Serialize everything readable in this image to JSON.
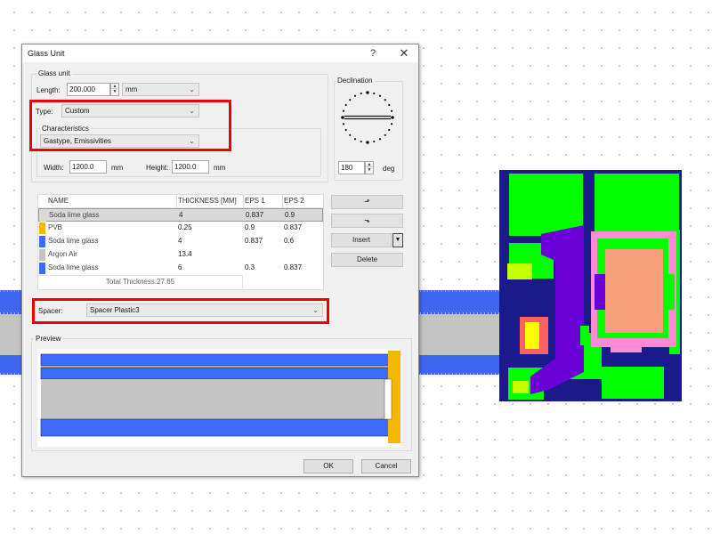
{
  "window": {
    "title": "Glass Unit",
    "help": "?",
    "close": "✕"
  },
  "glass_unit": {
    "group_label": "Glass unit",
    "length_label": "Length:",
    "length_value": "200.000",
    "length_unit": "mm",
    "type_label": "Type:",
    "type_value": "Custom",
    "characteristics_label": "Characteristics",
    "characteristics_value": "Gastype, Emissivities",
    "width_label": "Width:",
    "width_value": "1200.0",
    "width_unit": "mm",
    "height_label": "Height:",
    "height_value": "1200.0",
    "height_unit": "mm"
  },
  "declination": {
    "label": "Declination",
    "value": "180",
    "unit": "deg"
  },
  "layers_table": {
    "headers": [
      "NAME",
      "THICKNESS [MM]",
      "EPS 1",
      "EPS 2"
    ],
    "rows": [
      {
        "name": "Soda lime glass",
        "thickness": "4",
        "eps1": "0.837",
        "eps2": "0.9",
        "color": "#d9d9d9"
      },
      {
        "name": "PVB",
        "thickness": "0.25",
        "eps1": "0.9",
        "eps2": "0.837",
        "color": "#f5b800"
      },
      {
        "name": "Soda lime glass",
        "thickness": "4",
        "eps1": "0.837",
        "eps2": "0.6",
        "color": "#3d6aff"
      },
      {
        "name": "Argon Air",
        "thickness": "13.4",
        "eps1": "",
        "eps2": "",
        "color": "#c4c4c4"
      },
      {
        "name": "Soda lime glass",
        "thickness": "6",
        "eps1": "0.3",
        "eps2": "0.837",
        "color": "#3d6aff"
      }
    ],
    "total": "Total Thickness:27.65"
  },
  "side_buttons": {
    "move_up": "⬏",
    "move_down": "⬎",
    "insert": "Insert",
    "insert_dropdown": "▼",
    "delete": "Delete"
  },
  "spacer": {
    "label": "Spacer:",
    "value": "Spacer Plastic3"
  },
  "preview": {
    "label": "Preview"
  },
  "footer": {
    "ok": "OK",
    "cancel": "Cancel"
  },
  "icons": {
    "dropdown": "chevron-down-icon",
    "spin": "spin-arrows-icon",
    "move_up": "arrow-up-icon",
    "move_down": "arrow-down-icon"
  },
  "colors": {
    "glass_blue": "#3f66ee",
    "gas_gray": "#c3c3c3",
    "pvb_yellow": "#f5b800",
    "highlight_red": "#ee0000",
    "frame_green": "#00ff00",
    "frame_navy": "#1a1a8c",
    "insulation_orange": "#f5a07a",
    "gasket_pink": "#ff8ad8",
    "gasket_purple": "#6a00d6"
  }
}
